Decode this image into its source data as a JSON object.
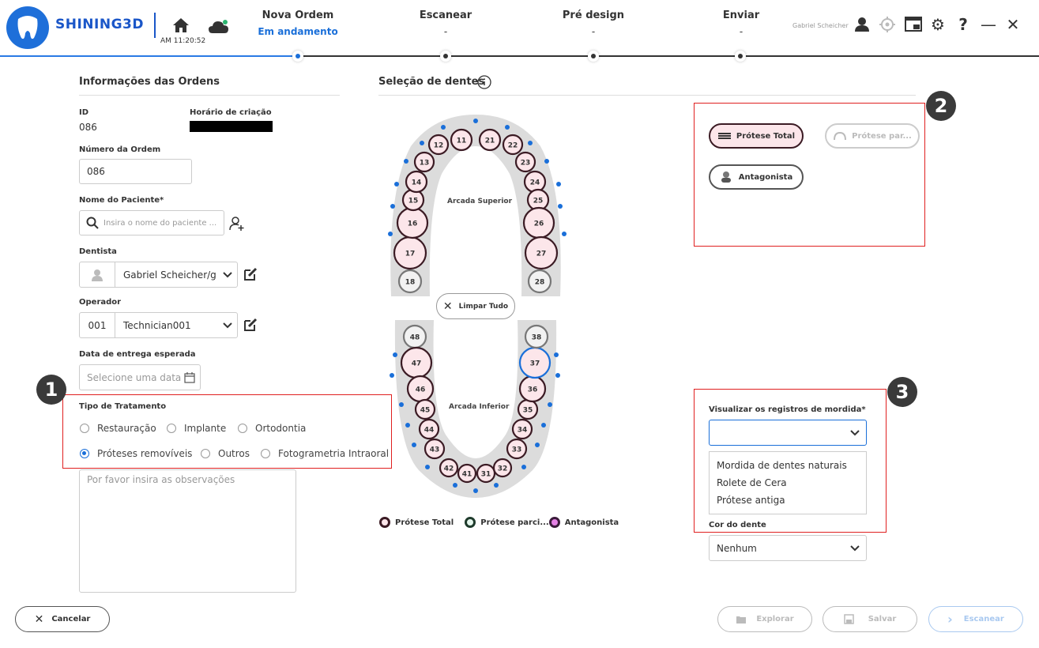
{
  "header": {
    "brand": "SHINING3D",
    "time": "AM 11:20:52",
    "steps": [
      {
        "title": "Nova Ordem",
        "status": "Em andamento"
      },
      {
        "title": "Escanear",
        "status": "-"
      },
      {
        "title": "Pré design",
        "status": "-"
      },
      {
        "title": "Enviar",
        "status": "-"
      }
    ],
    "user": "Gabriel Scheicher",
    "icons": [
      "home-icon",
      "cloud-icon",
      "user-icon",
      "target-icon",
      "screenshot-icon",
      "gear-icon",
      "help-icon",
      "minimize-icon",
      "close-icon"
    ]
  },
  "order_info": {
    "title": "Informações das Ordens",
    "id_label": "ID",
    "id_value": "086",
    "created_label": "Horário de criação",
    "order_number_label": "Número da Ordem",
    "order_number_value": "086",
    "patient_label": "Nome do Paciente*",
    "patient_placeholder": "Insira o nome do paciente ...",
    "dentist_label": "Dentista",
    "dentist_value": "Gabriel Scheicher/g",
    "operator_label": "Operador",
    "operator_code": "001",
    "operator_value": "Technician001",
    "delivery_label": "Data de entrega esperada",
    "delivery_placeholder": "Selecione uma data",
    "treatment_label": "Tipo de Tratamento",
    "treatment_options": [
      "Restauração",
      "Implante",
      "Ortodontia",
      "Próteses removíveis",
      "Outros",
      "Fotogrametria Intraoral"
    ],
    "treatment_selected": "Próteses removíveis",
    "notes_placeholder": "Por favor insira as observações"
  },
  "teeth": {
    "title": "Seleção de dentes",
    "upper_label": "Arcada Superior",
    "lower_label": "Arcada Inferior",
    "clear_all": "Limpar Tudo",
    "legend": [
      "Prótese Total",
      "Prótese parci...",
      "Antagonista"
    ],
    "upper_numbers": [
      "18",
      "17",
      "16",
      "15",
      "14",
      "13",
      "12",
      "11",
      "21",
      "22",
      "23",
      "24",
      "25",
      "26",
      "27",
      "28"
    ],
    "lower_numbers": [
      "48",
      "47",
      "46",
      "45",
      "44",
      "43",
      "42",
      "41",
      "31",
      "32",
      "33",
      "34",
      "35",
      "36",
      "37",
      "38"
    ]
  },
  "prosthesis": {
    "full": "Prótese Total",
    "partial": "Prótese par...",
    "antagonist": "Antagonista"
  },
  "bite": {
    "label": "Visualizar os registros de mordida*",
    "value": "",
    "options": [
      "Mordida de dentes naturais",
      "Rolete de Cera",
      "Prótese antiga"
    ],
    "color_label": "Cor do dente",
    "color_value": "Nenhum"
  },
  "badges": [
    "1",
    "2",
    "3"
  ],
  "footer": {
    "cancel": "Cancelar",
    "explore": "Explorar",
    "save": "Salvar",
    "scan": "Escanear"
  },
  "colors": {
    "accent": "#1a6fd9",
    "highlight": "#e02020",
    "tooth_fill": "#fce6ea",
    "tooth_border": "#3b1b24"
  }
}
